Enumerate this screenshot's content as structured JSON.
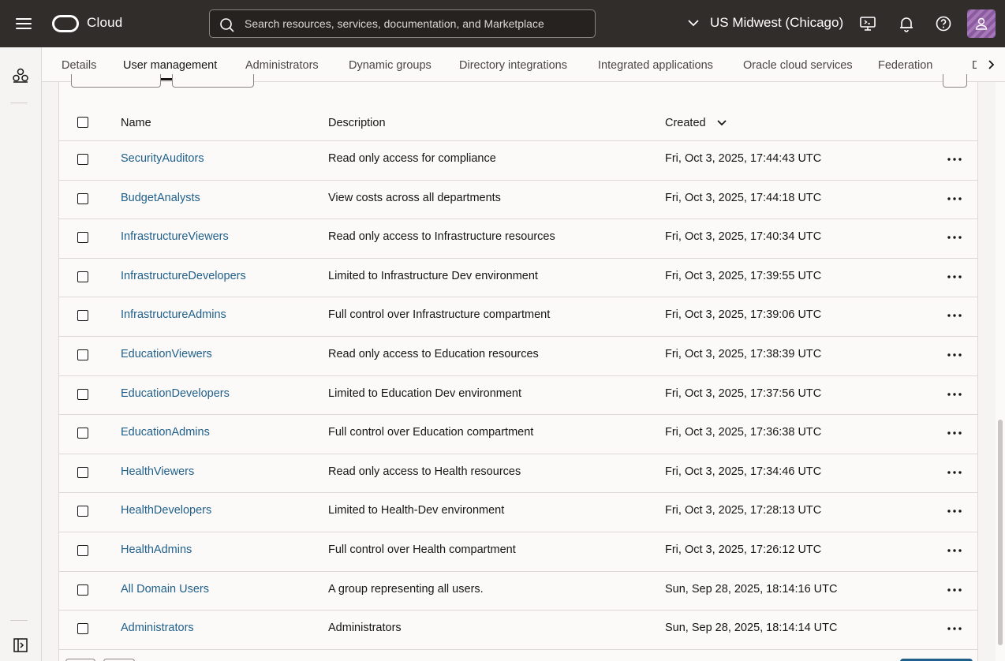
{
  "header": {
    "brand": "Cloud",
    "search_placeholder": "Search resources, services, documentation, and Marketplace",
    "region": "US Midwest (Chicago)"
  },
  "tabs": [
    {
      "label": "Details",
      "active": false
    },
    {
      "label": "User management",
      "active": true
    },
    {
      "label": "Administrators",
      "active": false
    },
    {
      "label": "Dynamic groups",
      "active": false
    },
    {
      "label": "Directory integrations",
      "active": false
    },
    {
      "label": "Integrated applications",
      "active": false
    },
    {
      "label": "Oracle cloud services",
      "active": false
    },
    {
      "label": "Federation",
      "active": false
    },
    {
      "label": "De",
      "active": false
    }
  ],
  "table": {
    "columns": {
      "name": "Name",
      "description": "Description",
      "created": "Created"
    },
    "rows": [
      {
        "name": "SecurityAuditors",
        "description": "Read only access for compliance",
        "created": "Fri, Oct 3, 2025, 17:44:43 UTC"
      },
      {
        "name": "BudgetAnalysts",
        "description": "View costs across all departments",
        "created": "Fri, Oct 3, 2025, 17:44:18 UTC"
      },
      {
        "name": "InfrastructureViewers",
        "description": "Read only access to Infrastructure resources",
        "created": "Fri, Oct 3, 2025, 17:40:34 UTC"
      },
      {
        "name": "InfrastructureDevelopers",
        "description": "Limited to Infrastructure Dev environment",
        "created": "Fri, Oct 3, 2025, 17:39:55 UTC"
      },
      {
        "name": "InfrastructureAdmins",
        "description": "Full control over Infrastructure compartment",
        "created": "Fri, Oct 3, 2025, 17:39:06 UTC"
      },
      {
        "name": "EducationViewers",
        "description": "Read only access to Education resources",
        "created": "Fri, Oct 3, 2025, 17:38:39 UTC"
      },
      {
        "name": "EducationDevelopers",
        "description": "Limited to Education Dev environment",
        "created": "Fri, Oct 3, 2025, 17:37:56 UTC"
      },
      {
        "name": "EducationAdmins",
        "description": "Full control over Education compartment",
        "created": "Fri, Oct 3, 2025, 17:36:38 UTC"
      },
      {
        "name": "HealthViewers",
        "description": "Read only access to Health resources",
        "created": "Fri, Oct 3, 2025, 17:34:46 UTC"
      },
      {
        "name": "HealthDevelopers",
        "description": "Limited to Health-Dev environment",
        "created": "Fri, Oct 3, 2025, 17:28:13 UTC"
      },
      {
        "name": "HealthAdmins",
        "description": "Full control over Health compartment",
        "created": "Fri, Oct 3, 2025, 17:26:12 UTC"
      },
      {
        "name": "All Domain Users",
        "description": "A group representing all users.",
        "created": "Sun, Sep 28, 2025, 18:14:16 UTC"
      },
      {
        "name": "Administrators",
        "description": "Administrators",
        "created": "Sun, Sep 28, 2025, 18:14:14 UTC"
      }
    ]
  }
}
